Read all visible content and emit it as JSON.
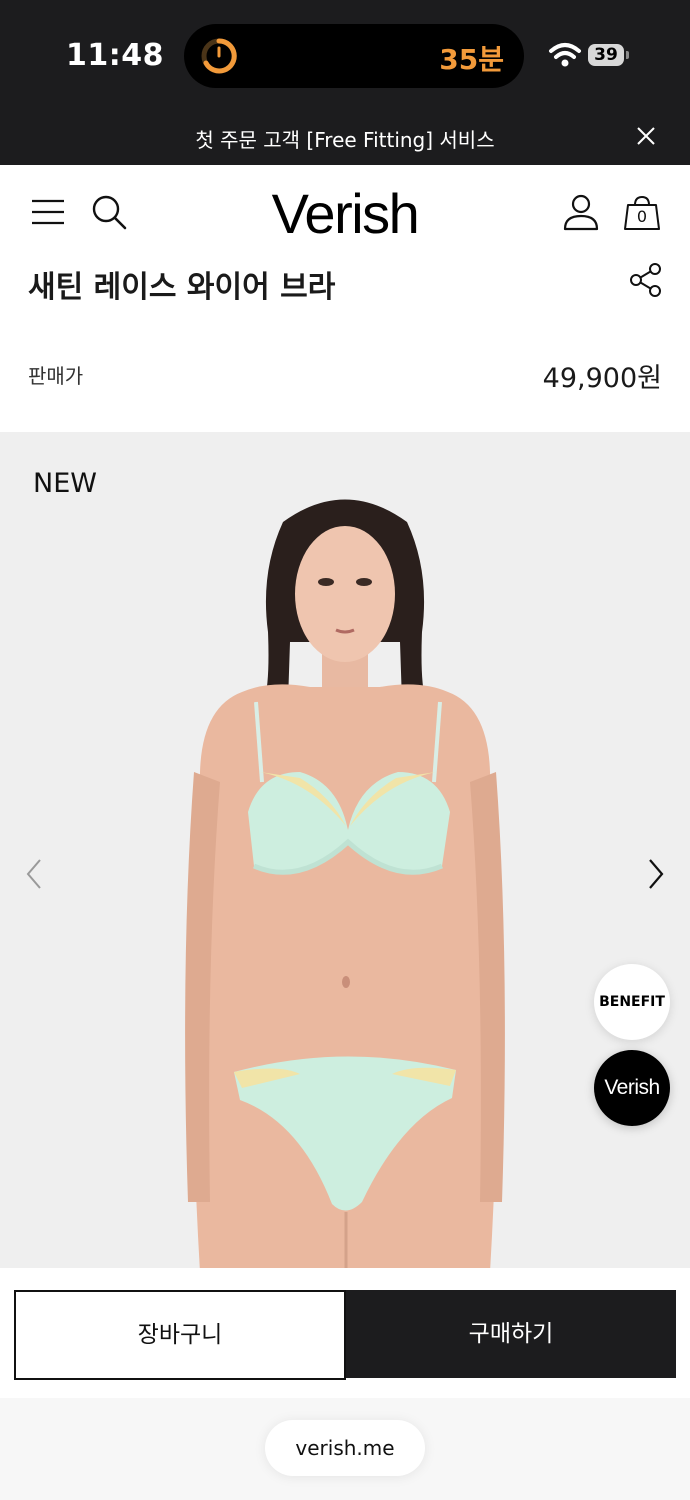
{
  "status_bar": {
    "time": "11:48",
    "island_text": "35분",
    "battery_level": "39",
    "timer_color": "#f29a3a"
  },
  "promo_banner": {
    "text": "첫 주문 고객 [Free Fitting] 서비스",
    "close_icon": "close-icon"
  },
  "header": {
    "logo": "Verish",
    "cart_count": "0",
    "icons": [
      "menu-icon",
      "search-icon",
      "user-icon",
      "shopping-bag-icon"
    ]
  },
  "product": {
    "title": "새틴 레이스 와이어 브라",
    "price_label": "판매가",
    "price": "49,900원",
    "badge": "NEW"
  },
  "floating": {
    "benefit_label": "BENEFIT",
    "verish_label": "Verish"
  },
  "actions": {
    "cart_label": "장바구니",
    "buy_label": "구매하기"
  },
  "browser": {
    "url": "verish.me"
  },
  "colors": {
    "dark": "#1c1c1e",
    "gallery_bg": "#efefef",
    "garment": "#cfeee0",
    "lace": "#f1e4a8"
  }
}
